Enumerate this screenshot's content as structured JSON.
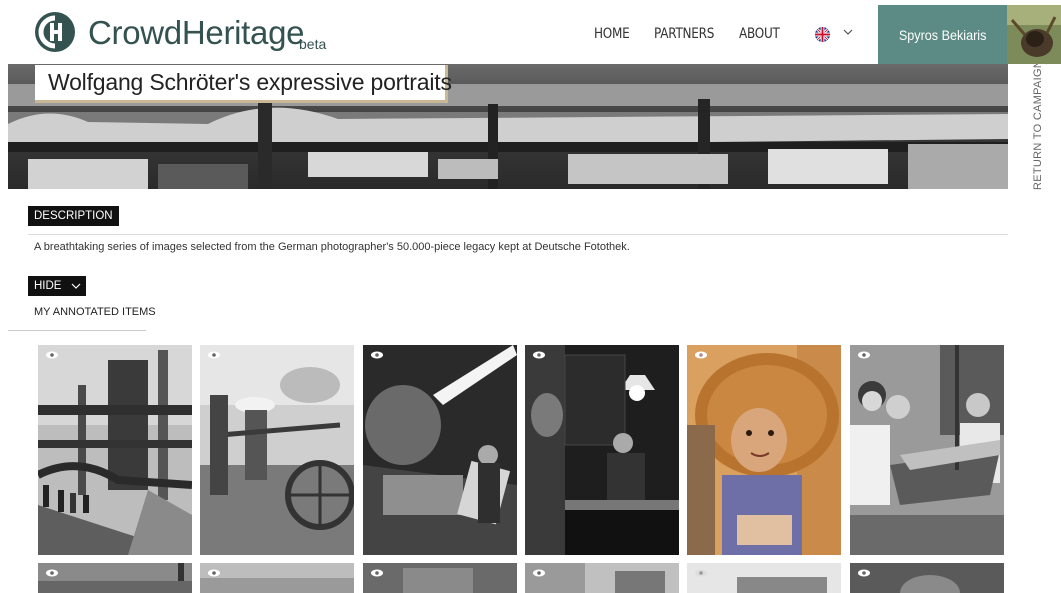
{
  "header": {
    "logo_text": "CrowdHeritage",
    "logo_beta": "beta",
    "nav": [
      "HOME",
      "PARTNERS",
      "ABOUT"
    ],
    "user_name": "Spyros Bekiaris"
  },
  "campaign": {
    "title": "Wolfgang Schröter's expressive portraits",
    "return_label": "RETURN TO CAMPAIGN >",
    "description_tag": "DESCRIPTION",
    "description": "A breathtaking series of images selected from the German photographer's 50.000-piece legacy kept at Deutsche Fotothek.",
    "hide_label": "HIDE",
    "annotated_label": "MY ANNOTATED ITEMS"
  },
  "colors": {
    "brand": "#34524f",
    "user_button": "#5b8b84",
    "title_border": "#c8b895"
  }
}
